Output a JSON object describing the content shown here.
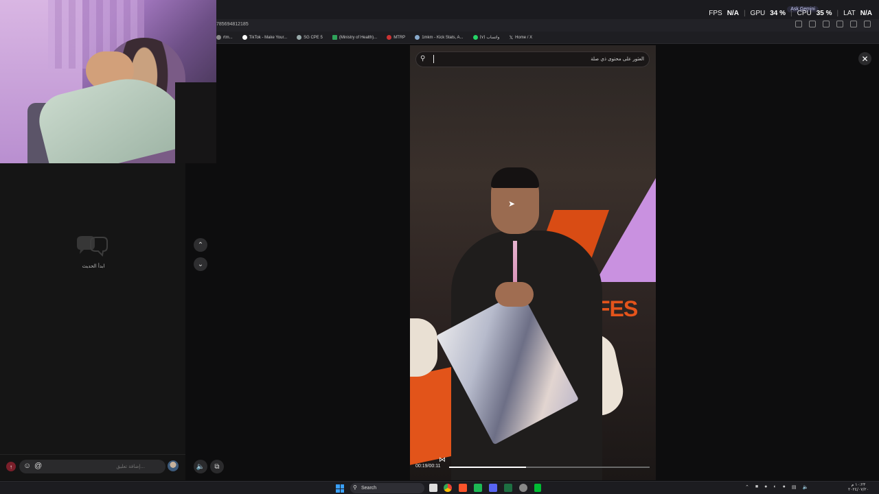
{
  "browser": {
    "url_fragment": "785694812185",
    "bookmarks": [
      {
        "label": "rtm...",
        "icon": "bookmark-icon"
      },
      {
        "label": "TikTok - Make Your...",
        "icon": "tiktok-icon"
      },
      {
        "label": "SG CPE 5",
        "icon": "globe-icon"
      },
      {
        "label": "(Ministry of Health)...",
        "icon": "sheet-icon"
      },
      {
        "label": "MTRP",
        "icon": "bookmark-icon"
      },
      {
        "label": "1mkm - Kick Stats, A...",
        "icon": "globe-icon"
      },
      {
        "label": "واتساب (٧)",
        "icon": "whatsapp-icon"
      },
      {
        "label": "Home / X",
        "icon": "x-icon"
      }
    ],
    "gemini_label": "Ask Gemini"
  },
  "perf": {
    "fps_label": "FPS",
    "fps_value": "N/A",
    "gpu_label": "GPU",
    "gpu_value": "34 %",
    "cpu_label": "CPU",
    "cpu_value": "35 %",
    "lat_label": "LAT",
    "lat_value": "N/A"
  },
  "comments": {
    "empty_label": "ابدأ الحديث",
    "input_placeholder": "إضافة تعليق..."
  },
  "video": {
    "search_placeholder": "العثور على محتوى ذي صلة",
    "time": "00:19/00:11",
    "progress": 0.385,
    "poster_text": "FES"
  },
  "taskbar": {
    "search_label": "Search",
    "clock_time": "١٠:٢٣ م",
    "clock_date": "٢٠٢٤/٠٧/٢٠"
  },
  "colors": {
    "page_bg": "#0d0d0e",
    "accent_orange": "#e2541a",
    "accent_purple": "#c991e0"
  }
}
